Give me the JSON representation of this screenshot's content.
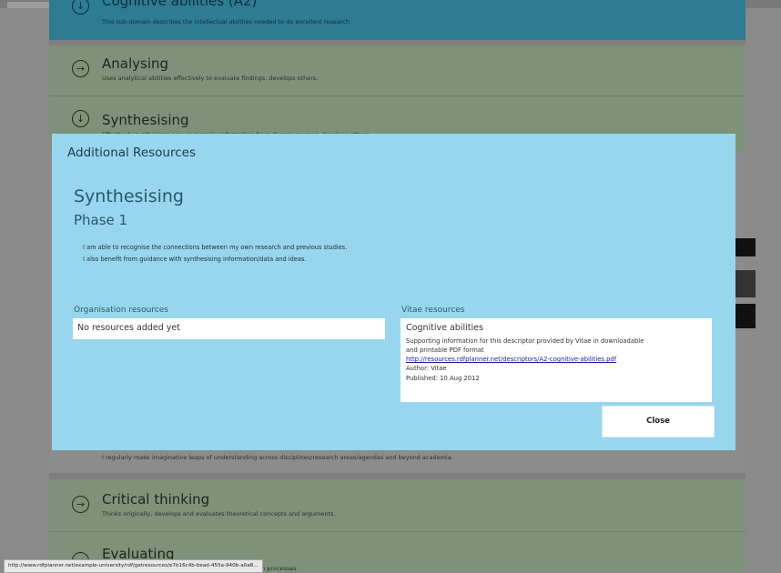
{
  "status_bar": {
    "url": "http://www.rdfplanner.net/example-university/rdf/getresources/e7b16c4b-bead-455a-940b-a0a8..."
  },
  "background_rows": {
    "cognitive": {
      "title": "Cognitive abilities (A2)",
      "desc": "This sub-domain describes the intellectual abilities needed to do excellent research.",
      "icon": "arrow-down-circle-icon"
    },
    "analysing": {
      "title": "Analysing",
      "desc": "Uses analytical abilities effectively to evaluate findings, develops others.",
      "icon": "arrow-right-circle-icon"
    },
    "synthesising": {
      "title": "Synthesising",
      "desc": "Effectively synthesises new or complex information from diverse sources, develops others.",
      "icon": "arrow-down-circle-icon"
    },
    "creative_desc": "I regularly make imaginative leaps of understanding across disciplines/research areas/agendas and beyond academia.",
    "critical": {
      "title": "Critical thinking",
      "desc": "Thinks originally, develops and evaluates theoretical concepts and arguments.",
      "icon": "arrow-right-circle-icon"
    },
    "evaluating": {
      "title": "Evaluating",
      "desc": "valuation processes",
      "icon": "arrow-right-circle-icon"
    }
  },
  "modal": {
    "header": "Additional Resources",
    "title": "Synthesising",
    "phase": "Phase 1",
    "text_line1": "I am able to recognise the connections between my own research and previous studies.",
    "text_line2": "I also benefit from guidance with synthesising information/data and ideas.",
    "org_heading": "Organisation resources",
    "org_empty": "No resources added yet",
    "vitae_heading": "Vitae resources",
    "vitae": {
      "title": "Cognitive abilities",
      "desc_line1": "Supporting information for this descriptor provided by Vitae in downloadable",
      "desc_line2": "and printable PDF format",
      "link": "http://resources.rdfplanner.net/descriptors/A2-cognitive-abilities.pdf",
      "author": "Author: Vitae",
      "published": "Published: 10 Aug 2012"
    },
    "close_label": "Close"
  },
  "colors": {
    "modal_bg": "#98d6ee",
    "row_green": "#7e9279",
    "row_blue": "#2e7b94",
    "overlay": "#7f7f7f"
  }
}
